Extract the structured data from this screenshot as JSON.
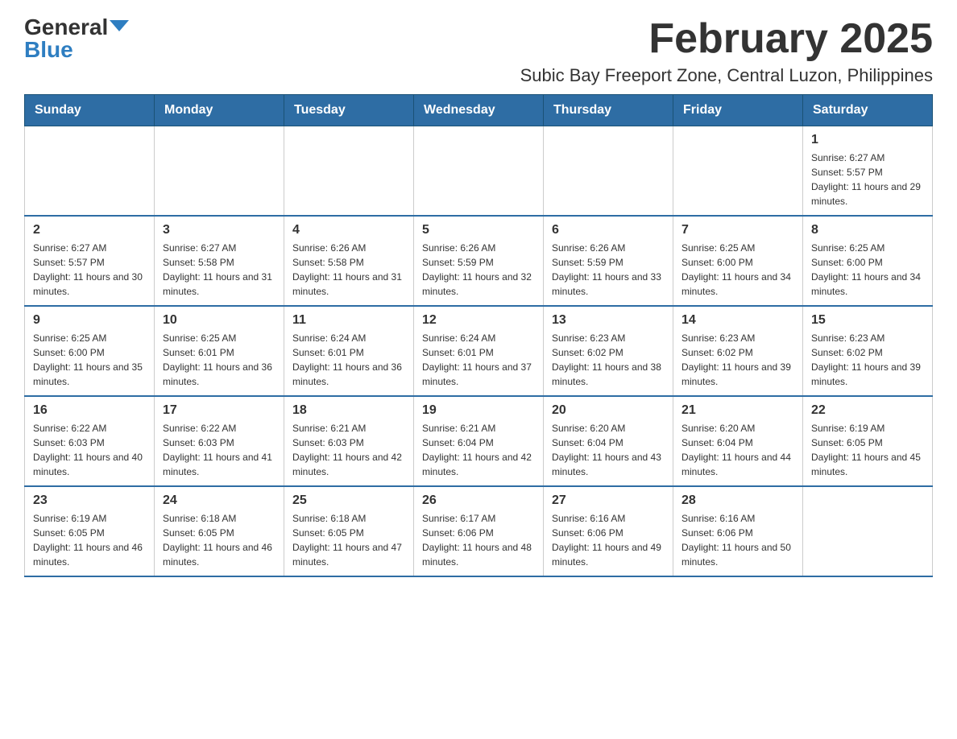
{
  "header": {
    "logo_general": "General",
    "logo_blue": "Blue",
    "title": "February 2025",
    "subtitle": "Subic Bay Freeport Zone, Central Luzon, Philippines"
  },
  "weekdays": [
    "Sunday",
    "Monday",
    "Tuesday",
    "Wednesday",
    "Thursday",
    "Friday",
    "Saturday"
  ],
  "weeks": [
    [
      {
        "day": "",
        "info": ""
      },
      {
        "day": "",
        "info": ""
      },
      {
        "day": "",
        "info": ""
      },
      {
        "day": "",
        "info": ""
      },
      {
        "day": "",
        "info": ""
      },
      {
        "day": "",
        "info": ""
      },
      {
        "day": "1",
        "info": "Sunrise: 6:27 AM\nSunset: 5:57 PM\nDaylight: 11 hours and 29 minutes."
      }
    ],
    [
      {
        "day": "2",
        "info": "Sunrise: 6:27 AM\nSunset: 5:57 PM\nDaylight: 11 hours and 30 minutes."
      },
      {
        "day": "3",
        "info": "Sunrise: 6:27 AM\nSunset: 5:58 PM\nDaylight: 11 hours and 31 minutes."
      },
      {
        "day": "4",
        "info": "Sunrise: 6:26 AM\nSunset: 5:58 PM\nDaylight: 11 hours and 31 minutes."
      },
      {
        "day": "5",
        "info": "Sunrise: 6:26 AM\nSunset: 5:59 PM\nDaylight: 11 hours and 32 minutes."
      },
      {
        "day": "6",
        "info": "Sunrise: 6:26 AM\nSunset: 5:59 PM\nDaylight: 11 hours and 33 minutes."
      },
      {
        "day": "7",
        "info": "Sunrise: 6:25 AM\nSunset: 6:00 PM\nDaylight: 11 hours and 34 minutes."
      },
      {
        "day": "8",
        "info": "Sunrise: 6:25 AM\nSunset: 6:00 PM\nDaylight: 11 hours and 34 minutes."
      }
    ],
    [
      {
        "day": "9",
        "info": "Sunrise: 6:25 AM\nSunset: 6:00 PM\nDaylight: 11 hours and 35 minutes."
      },
      {
        "day": "10",
        "info": "Sunrise: 6:25 AM\nSunset: 6:01 PM\nDaylight: 11 hours and 36 minutes."
      },
      {
        "day": "11",
        "info": "Sunrise: 6:24 AM\nSunset: 6:01 PM\nDaylight: 11 hours and 36 minutes."
      },
      {
        "day": "12",
        "info": "Sunrise: 6:24 AM\nSunset: 6:01 PM\nDaylight: 11 hours and 37 minutes."
      },
      {
        "day": "13",
        "info": "Sunrise: 6:23 AM\nSunset: 6:02 PM\nDaylight: 11 hours and 38 minutes."
      },
      {
        "day": "14",
        "info": "Sunrise: 6:23 AM\nSunset: 6:02 PM\nDaylight: 11 hours and 39 minutes."
      },
      {
        "day": "15",
        "info": "Sunrise: 6:23 AM\nSunset: 6:02 PM\nDaylight: 11 hours and 39 minutes."
      }
    ],
    [
      {
        "day": "16",
        "info": "Sunrise: 6:22 AM\nSunset: 6:03 PM\nDaylight: 11 hours and 40 minutes."
      },
      {
        "day": "17",
        "info": "Sunrise: 6:22 AM\nSunset: 6:03 PM\nDaylight: 11 hours and 41 minutes."
      },
      {
        "day": "18",
        "info": "Sunrise: 6:21 AM\nSunset: 6:03 PM\nDaylight: 11 hours and 42 minutes."
      },
      {
        "day": "19",
        "info": "Sunrise: 6:21 AM\nSunset: 6:04 PM\nDaylight: 11 hours and 42 minutes."
      },
      {
        "day": "20",
        "info": "Sunrise: 6:20 AM\nSunset: 6:04 PM\nDaylight: 11 hours and 43 minutes."
      },
      {
        "day": "21",
        "info": "Sunrise: 6:20 AM\nSunset: 6:04 PM\nDaylight: 11 hours and 44 minutes."
      },
      {
        "day": "22",
        "info": "Sunrise: 6:19 AM\nSunset: 6:05 PM\nDaylight: 11 hours and 45 minutes."
      }
    ],
    [
      {
        "day": "23",
        "info": "Sunrise: 6:19 AM\nSunset: 6:05 PM\nDaylight: 11 hours and 46 minutes."
      },
      {
        "day": "24",
        "info": "Sunrise: 6:18 AM\nSunset: 6:05 PM\nDaylight: 11 hours and 46 minutes."
      },
      {
        "day": "25",
        "info": "Sunrise: 6:18 AM\nSunset: 6:05 PM\nDaylight: 11 hours and 47 minutes."
      },
      {
        "day": "26",
        "info": "Sunrise: 6:17 AM\nSunset: 6:06 PM\nDaylight: 11 hours and 48 minutes."
      },
      {
        "day": "27",
        "info": "Sunrise: 6:16 AM\nSunset: 6:06 PM\nDaylight: 11 hours and 49 minutes."
      },
      {
        "day": "28",
        "info": "Sunrise: 6:16 AM\nSunset: 6:06 PM\nDaylight: 11 hours and 50 minutes."
      },
      {
        "day": "",
        "info": ""
      }
    ]
  ]
}
